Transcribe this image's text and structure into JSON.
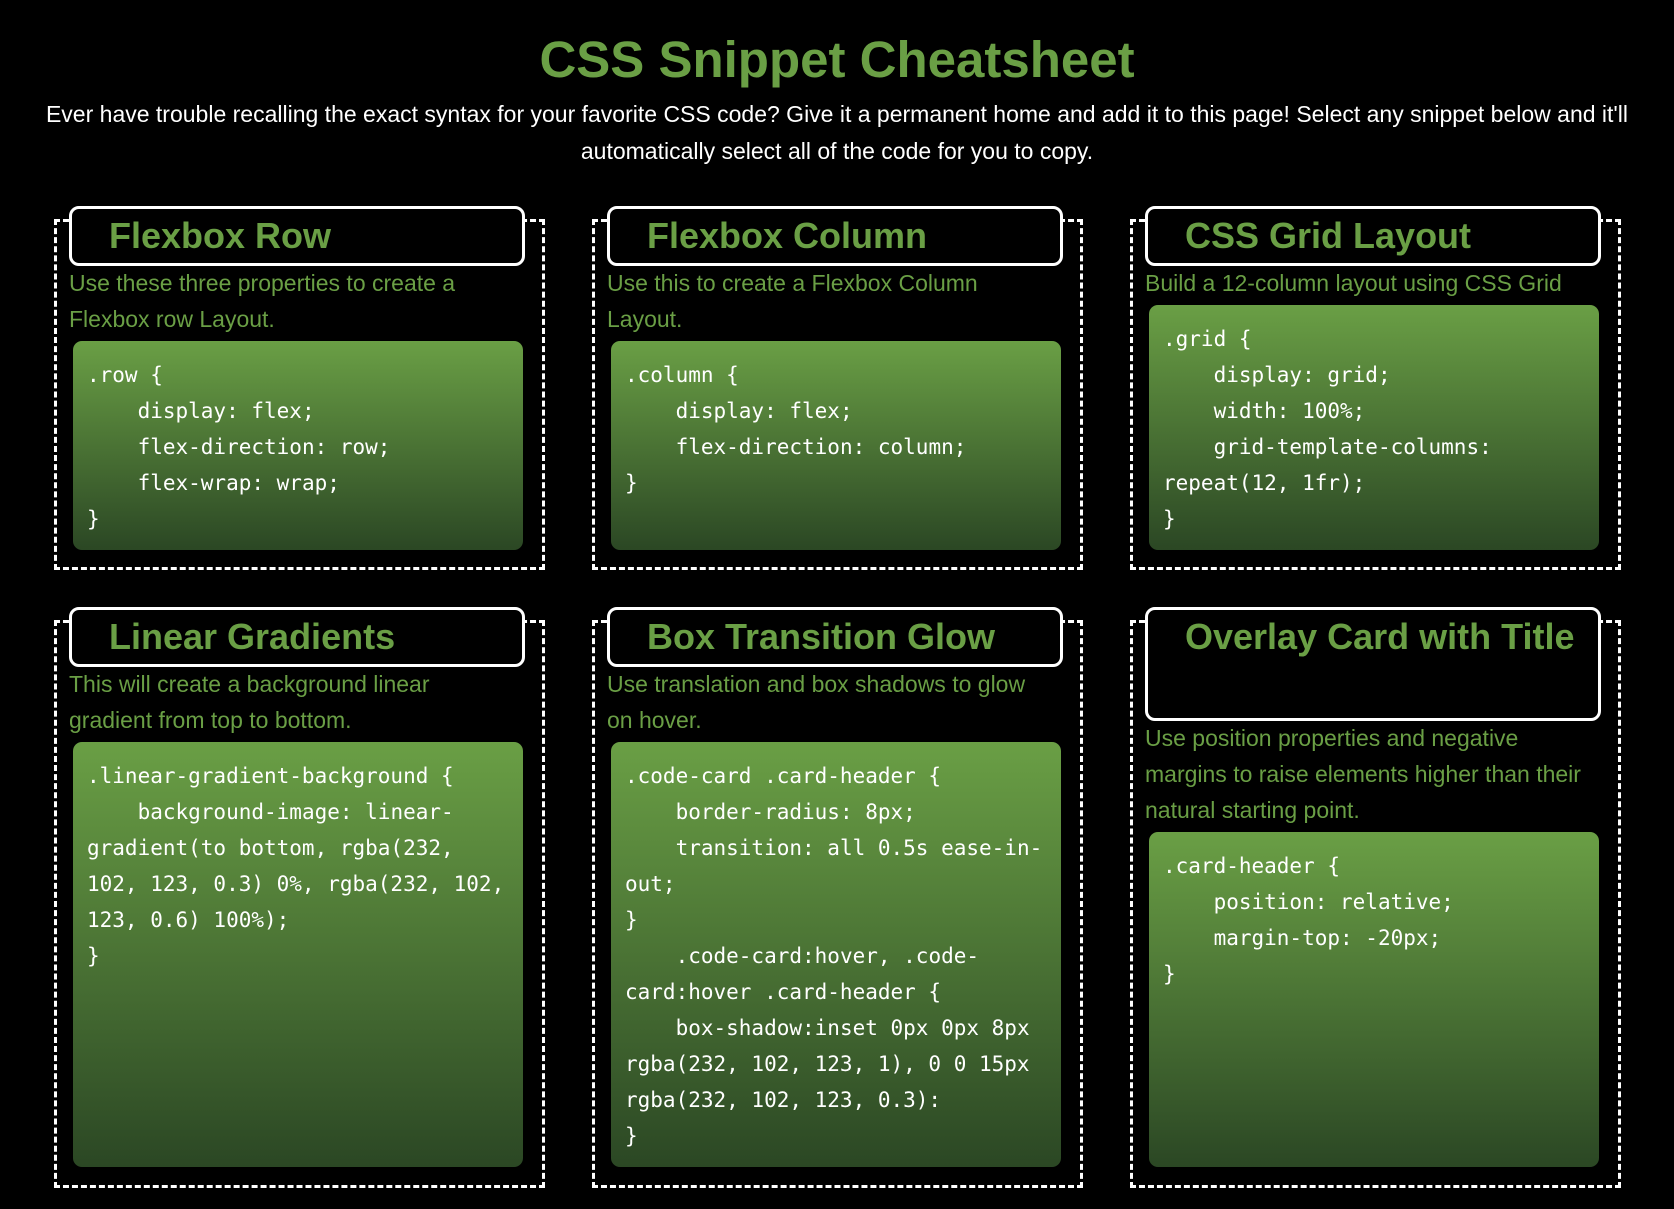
{
  "page": {
    "title": "CSS Snippet Cheatsheet",
    "intro": "Ever have trouble recalling the exact syntax for your favorite CSS code? Give it a permanent home and add it to this page! Select any snippet below and it'll automatically select all of the code for you to copy."
  },
  "cards": [
    {
      "title": "Flexbox Row",
      "description": "Use these three properties to create a Flexbox row Layout.",
      "code": ".row {\n    display: flex;\n    flex-direction: row;\n    flex-wrap: wrap;\n}"
    },
    {
      "title": "Flexbox Column",
      "description": "Use this to create a Flexbox Column Layout.",
      "code": ".column {\n    display: flex;\n    flex-direction: column;\n}"
    },
    {
      "title": "CSS Grid Layout",
      "description": "Build a 12-column layout using CSS Grid",
      "code": ".grid {\n    display: grid;\n    width: 100%;\n    grid-template-columns: repeat(12, 1fr);\n}"
    },
    {
      "title": "Linear Gradients",
      "description": "This will create a background linear gradient from top to bottom.",
      "code": ".linear-gradient-background {\n    background-image: linear-gradient(to bottom, rgba(232, 102, 123, 0.3) 0%, rgba(232, 102, 123, 0.6) 100%);\n}"
    },
    {
      "title": "Box Transition Glow",
      "description": "Use translation and box shadows to glow on hover.",
      "code": ".code-card .card-header {\n    border-radius: 8px;\n    transition: all 0.5s ease-in-out;\n}\n    .code-card:hover, .code-card:hover .card-header {\n    box-shadow:inset 0px 0px 8px rgba(232, 102, 123, 1), 0 0 15px rgba(232, 102, 123, 0.3):\n}"
    },
    {
      "title": "Overlay Card with Title",
      "description": "Use position properties and negative margins to raise elements higher than their natural starting point.",
      "code": ".card-header {\n    position: relative;\n    margin-top: -20px;\n}"
    }
  ],
  "colors": {
    "background": "#000000",
    "accent_green": "#6a9f45",
    "code_gradient_top": "#6a9f45",
    "code_gradient_bottom": "#2b4724",
    "text": "#ffffff"
  }
}
